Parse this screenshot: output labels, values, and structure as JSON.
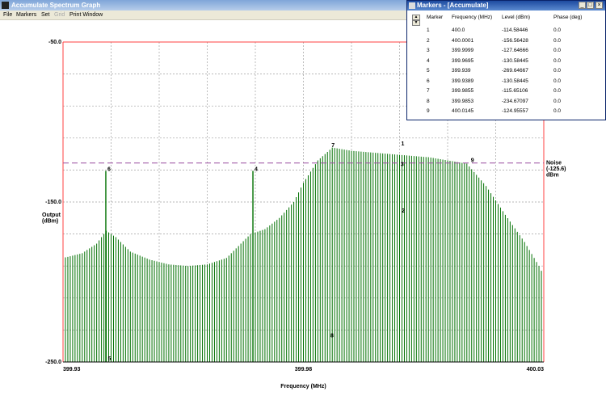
{
  "app": {
    "title": "Accumulate Spectrum Graph"
  },
  "menu": [
    {
      "label": "File",
      "enabled": true
    },
    {
      "label": "Markers",
      "enabled": true
    },
    {
      "label": "Set",
      "enabled": true
    },
    {
      "label": "Grid",
      "enabled": false
    },
    {
      "label": "Print Window",
      "enabled": true
    }
  ],
  "markers_window": {
    "title": "Markers - [Accumulate]",
    "columns": [
      "Marker",
      "Frequency (MHz)",
      "Level (dBm)",
      "Phase (deg)"
    ],
    "rows": [
      [
        "1",
        "400.0",
        "-114.58446",
        "0.0"
      ],
      [
        "2",
        "400.0001",
        "-156.56428",
        "0.0"
      ],
      [
        "3",
        "399.9999",
        "-127.64666",
        "0.0"
      ],
      [
        "4",
        "399.9695",
        "-130.58445",
        "0.0"
      ],
      [
        "5",
        "399.939",
        "-269.64667",
        "0.0"
      ],
      [
        "6",
        "399.9389",
        "-130.58445",
        "0.0"
      ],
      [
        "7",
        "399.9855",
        "-115.65106",
        "0.0"
      ],
      [
        "8",
        "399.9853",
        "-234.67097",
        "0.0"
      ],
      [
        "9",
        "400.0145",
        "-124.95557",
        "0.0"
      ]
    ]
  },
  "chart_data": {
    "type": "bar",
    "xlabel": "Frequency (MHz)",
    "ylabel": "Output\n(dBm)",
    "xlim": [
      399.93,
      400.03
    ],
    "ylim": [
      -250,
      -50
    ],
    "x_tick_labels": [
      "399.93",
      "399.98",
      "400.03"
    ],
    "y_tick_labels": [
      "-50.0",
      "-150.0",
      "-250.0"
    ],
    "grid": true,
    "noise": {
      "label": "Noise\n(-125.6)\ndBm",
      "value": -125.6,
      "color": "#9a4fa0"
    },
    "series_color": "#007000",
    "background_color": "#ffffff",
    "frame_color": "#ff4040",
    "markers": [
      {
        "label": "1",
        "x": 400.0,
        "y": -114.58
      },
      {
        "label": "2",
        "x": 400.0001,
        "y": -156.56
      },
      {
        "label": "3",
        "x": 399.9999,
        "y": -127.65
      },
      {
        "label": "4",
        "x": 399.9695,
        "y": -130.58
      },
      {
        "label": "5",
        "x": 399.939,
        "y": -249.0
      },
      {
        "label": "6",
        "x": 399.9389,
        "y": -130.58
      },
      {
        "label": "7",
        "x": 399.9855,
        "y": -115.65
      },
      {
        "label": "8",
        "x": 399.9853,
        "y": -234.67
      },
      {
        "label": "9",
        "x": 400.0145,
        "y": -124.96
      }
    ],
    "envelope": [
      [
        399.93,
        -185
      ],
      [
        399.934,
        -182
      ],
      [
        399.937,
        -176
      ],
      [
        399.939,
        -168
      ],
      [
        399.941,
        -172
      ],
      [
        399.944,
        -181
      ],
      [
        399.948,
        -186
      ],
      [
        399.952,
        -189
      ],
      [
        399.956,
        -190
      ],
      [
        399.96,
        -189
      ],
      [
        399.964,
        -185
      ],
      [
        399.967,
        -176
      ],
      [
        399.969,
        -170
      ],
      [
        399.972,
        -167
      ],
      [
        399.975,
        -160
      ],
      [
        399.978,
        -150
      ],
      [
        399.98,
        -138
      ],
      [
        399.983,
        -124
      ],
      [
        399.986,
        -116
      ],
      [
        399.99,
        -118
      ],
      [
        399.994,
        -119
      ],
      [
        399.998,
        -120
      ],
      [
        400.002,
        -121
      ],
      [
        400.006,
        -122
      ],
      [
        400.01,
        -124
      ],
      [
        400.014,
        -126
      ],
      [
        400.018,
        -140
      ],
      [
        400.022,
        -158
      ],
      [
        400.026,
        -175
      ],
      [
        400.029,
        -190
      ],
      [
        400.03,
        -196
      ]
    ]
  }
}
